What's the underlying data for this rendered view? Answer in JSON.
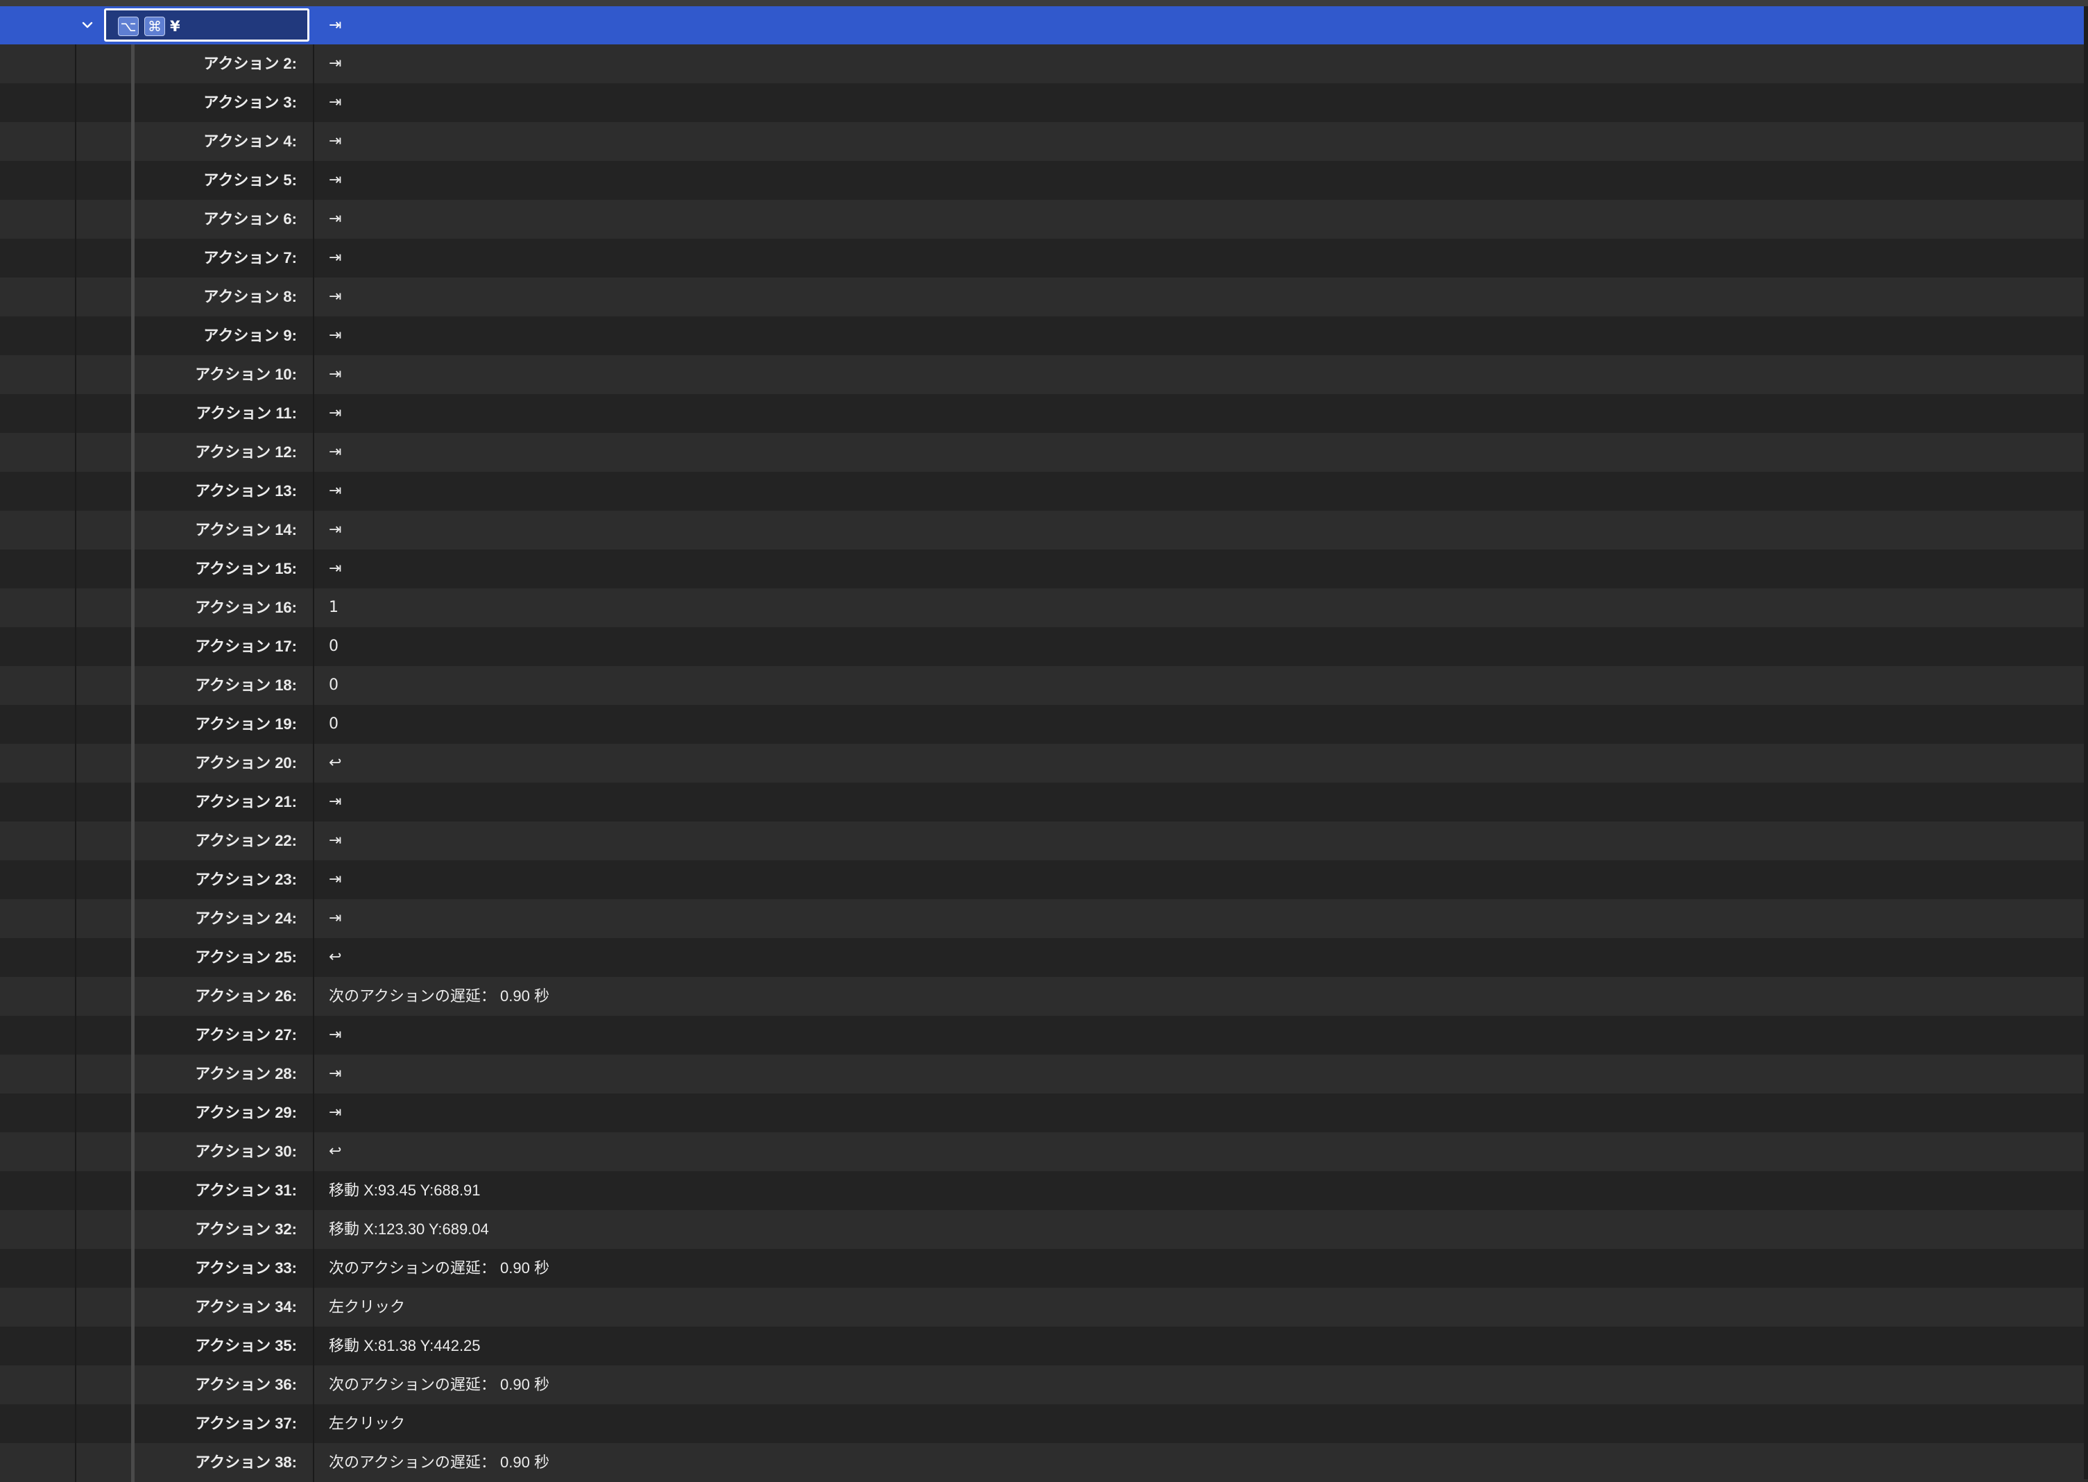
{
  "header": {
    "shortcut_keys": [
      "⌥",
      "⌘"
    ],
    "shortcut_char": "¥",
    "first_action_value": "⇥"
  },
  "colors": {
    "selection": "#3159cc",
    "row_odd": "#232323",
    "row_even": "#2d2d2d",
    "text": "#ececec"
  },
  "actions": [
    {
      "label": "アクション 2:",
      "value": "⇥"
    },
    {
      "label": "アクション 3:",
      "value": "⇥"
    },
    {
      "label": "アクション 4:",
      "value": "⇥"
    },
    {
      "label": "アクション 5:",
      "value": "⇥"
    },
    {
      "label": "アクション 6:",
      "value": "⇥"
    },
    {
      "label": "アクション 7:",
      "value": "⇥"
    },
    {
      "label": "アクション 8:",
      "value": "⇥"
    },
    {
      "label": "アクション 9:",
      "value": "⇥"
    },
    {
      "label": "アクション 10:",
      "value": "⇥"
    },
    {
      "label": "アクション 11:",
      "value": "⇥"
    },
    {
      "label": "アクション 12:",
      "value": "⇥"
    },
    {
      "label": "アクション 13:",
      "value": "⇥"
    },
    {
      "label": "アクション 14:",
      "value": "⇥"
    },
    {
      "label": "アクション 15:",
      "value": "⇥"
    },
    {
      "label": "アクション 16:",
      "value": "1"
    },
    {
      "label": "アクション 17:",
      "value": "0"
    },
    {
      "label": "アクション 18:",
      "value": "0"
    },
    {
      "label": "アクション 19:",
      "value": "0"
    },
    {
      "label": "アクション 20:",
      "value": "↩"
    },
    {
      "label": "アクション 21:",
      "value": "⇥"
    },
    {
      "label": "アクション 22:",
      "value": "⇥"
    },
    {
      "label": "アクション 23:",
      "value": "⇥"
    },
    {
      "label": "アクション 24:",
      "value": "⇥"
    },
    {
      "label": "アクション 25:",
      "value": "↩"
    },
    {
      "label": "アクション 26:",
      "value": "次のアクションの遅延： 0.90 秒"
    },
    {
      "label": "アクション 27:",
      "value": "⇥"
    },
    {
      "label": "アクション 28:",
      "value": "⇥"
    },
    {
      "label": "アクション 29:",
      "value": "⇥"
    },
    {
      "label": "アクション 30:",
      "value": "↩"
    },
    {
      "label": "アクション 31:",
      "value": "移動 X:93.45 Y:688.91"
    },
    {
      "label": "アクション 32:",
      "value": "移動 X:123.30 Y:689.04"
    },
    {
      "label": "アクション 33:",
      "value": "次のアクションの遅延： 0.90 秒"
    },
    {
      "label": "アクション 34:",
      "value": "左クリック"
    },
    {
      "label": "アクション 35:",
      "value": "移動 X:81.38 Y:442.25"
    },
    {
      "label": "アクション 36:",
      "value": "次のアクションの遅延： 0.90 秒"
    },
    {
      "label": "アクション 37:",
      "value": "左クリック"
    },
    {
      "label": "アクション 38:",
      "value": "次のアクションの遅延： 0.90 秒"
    }
  ]
}
